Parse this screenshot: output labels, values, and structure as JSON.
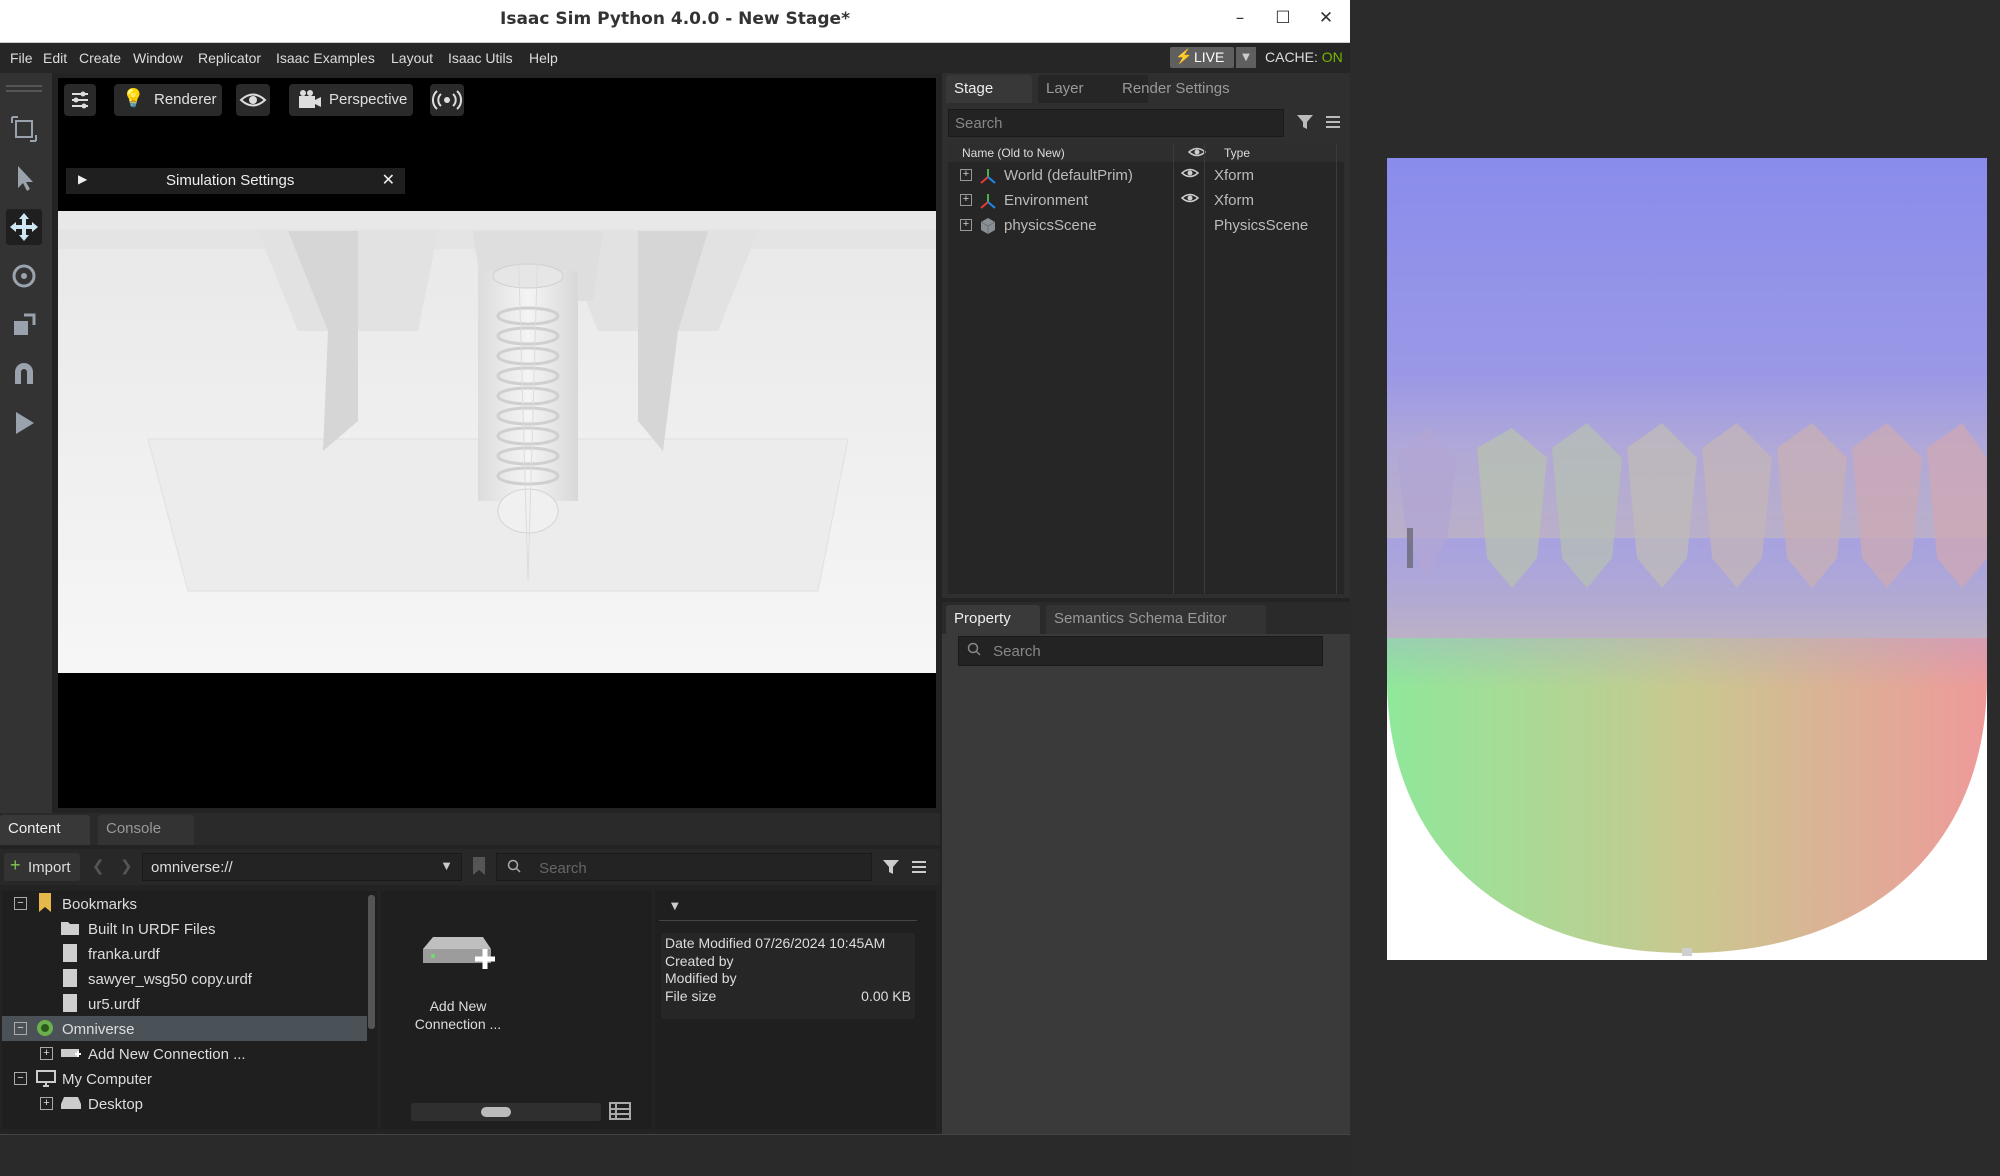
{
  "window": {
    "title": "Isaac Sim Python 4.0.0 - New Stage*",
    "controls": {
      "minimize": "–",
      "maximize": "☐",
      "close": "✕"
    }
  },
  "menu": {
    "items": [
      "File",
      "Edit",
      "Create",
      "Window",
      "Replicator",
      "Isaac Examples",
      "Layout",
      "Isaac Utils",
      "Help"
    ]
  },
  "status": {
    "live_label": "LIVE",
    "cache_label": "CACHE:",
    "cache_value": "ON",
    "cache_on_color": "#76b900"
  },
  "left_toolbar": {
    "tools": [
      "select-mode-icon",
      "pointer-icon",
      "move-icon",
      "rotate-icon",
      "scale-icon",
      "snap-magnet-icon",
      "play-icon"
    ]
  },
  "viewport": {
    "renderer_label": "Renderer",
    "camera_label": "Perspective",
    "sim_settings_label": "Simulation Settings"
  },
  "stage": {
    "tabs": [
      "Stage",
      "Layer",
      "Render Settings"
    ],
    "search_placeholder": "Search",
    "columns": {
      "name": "Name (Old to New)",
      "type": "Type"
    },
    "rows": [
      {
        "name": "World (defaultPrim)",
        "type": "Xform",
        "visible": true
      },
      {
        "name": "Environment",
        "type": "Xform",
        "visible": true
      },
      {
        "name": "physicsScene",
        "type": "PhysicsScene",
        "visible": false
      }
    ]
  },
  "property": {
    "tabs": [
      "Property",
      "Semantics Schema Editor"
    ],
    "search_placeholder": "Search"
  },
  "content": {
    "tabs": [
      "Content",
      "Console"
    ],
    "import_label": "Import",
    "path_value": "omniverse://",
    "search_placeholder": "Search",
    "tree": [
      {
        "label": "Bookmarks",
        "level": 0,
        "expander": "−",
        "icon": "bookmark-icon"
      },
      {
        "label": "Built In URDF Files",
        "level": 1,
        "icon": "folder-icon"
      },
      {
        "label": "franka.urdf",
        "level": 1,
        "icon": "file-icon"
      },
      {
        "label": "sawyer_wsg50 copy.urdf",
        "level": 1,
        "icon": "file-icon"
      },
      {
        "label": "ur5.urdf",
        "level": 1,
        "icon": "file-icon"
      },
      {
        "label": "Omniverse",
        "level": 0,
        "expander": "−",
        "icon": "omniverse-icon",
        "selected": true
      },
      {
        "label": "Add New Connection ...",
        "level": 1,
        "expander": "+",
        "icon": "server-icon"
      },
      {
        "label": "My Computer",
        "level": 0,
        "expander": "−",
        "icon": "computer-icon"
      },
      {
        "label": "Desktop",
        "level": 1,
        "expander": "+",
        "icon": "drive-icon"
      }
    ],
    "grid_item": {
      "line1": "Add New",
      "line2": "Connection ..."
    },
    "details": {
      "date_modified_label": "Date Modified",
      "date_modified_value": "07/26/2024 10:45AM",
      "created_by_label": "Created by",
      "modified_by_label": "Modified by",
      "file_size_label": "File size",
      "file_size_value": "0.00 KB"
    }
  }
}
